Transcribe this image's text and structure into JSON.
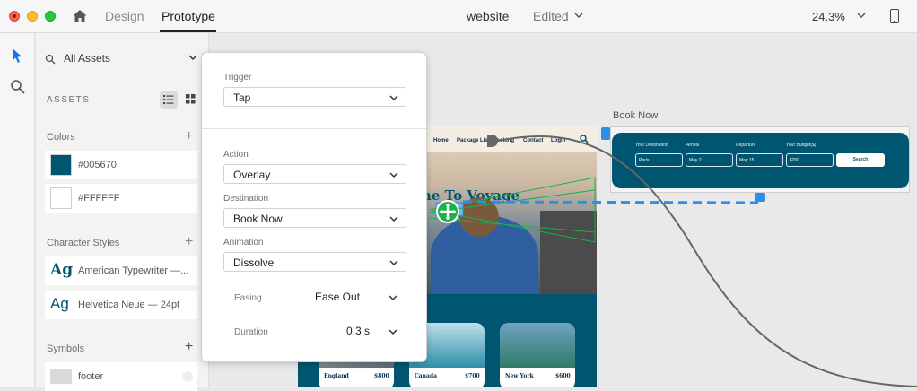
{
  "titlebar": {
    "tabs": [
      "Design",
      "Prototype"
    ],
    "active_tab": "Prototype",
    "document_title": "website",
    "document_status": "Edited",
    "zoom": "24.3%"
  },
  "assets_panel": {
    "filter": "All Assets",
    "heading": "ASSETS",
    "colors_label": "Colors",
    "colors": [
      {
        "name": "#005670",
        "hex": "#005670"
      },
      {
        "name": "#FFFFFF",
        "hex": "#FFFFFF"
      }
    ],
    "character_styles_label": "Character Styles",
    "character_styles": [
      {
        "glyph": "Ag",
        "name": "American Typewriter —..."
      },
      {
        "glyph": "Ag",
        "name": "Helvetica Neue — 24pt"
      }
    ],
    "symbols_label": "Symbols",
    "symbols": [
      {
        "name": "footer"
      }
    ]
  },
  "interaction_popup": {
    "trigger_label": "Trigger",
    "trigger_value": "Tap",
    "action_label": "Action",
    "action_value": "Overlay",
    "destination_label": "Destination",
    "destination_value": "Book Now",
    "animation_label": "Animation",
    "animation_value": "Dissolve",
    "easing_label": "Easing",
    "easing_value": "Ease Out",
    "duration_label": "Duration",
    "duration_value": "0.3 s"
  },
  "canvas": {
    "home_artboard": {
      "nav": [
        "Home",
        "Package List",
        "Booking",
        "Contact",
        "Login"
      ],
      "hero_title": "me To Voyage",
      "cards": [
        {
          "city": "England",
          "price": "$800"
        },
        {
          "city": "Canada",
          "price": "$700"
        },
        {
          "city": "New York",
          "price": "$600"
        }
      ]
    },
    "booknow_artboard": {
      "label": "Book Now",
      "fields": [
        {
          "label": "Your Destination",
          "value": "Paris"
        },
        {
          "label": "Arrival",
          "value": "May 2"
        },
        {
          "label": "Departure",
          "value": "May 15"
        },
        {
          "label": "Your Budget($)",
          "value": "$200"
        }
      ],
      "button": "Search"
    }
  },
  "colors": {
    "brand_teal": "#005670",
    "wire_green": "#1ab048",
    "link_blue": "#2d8fe5"
  }
}
